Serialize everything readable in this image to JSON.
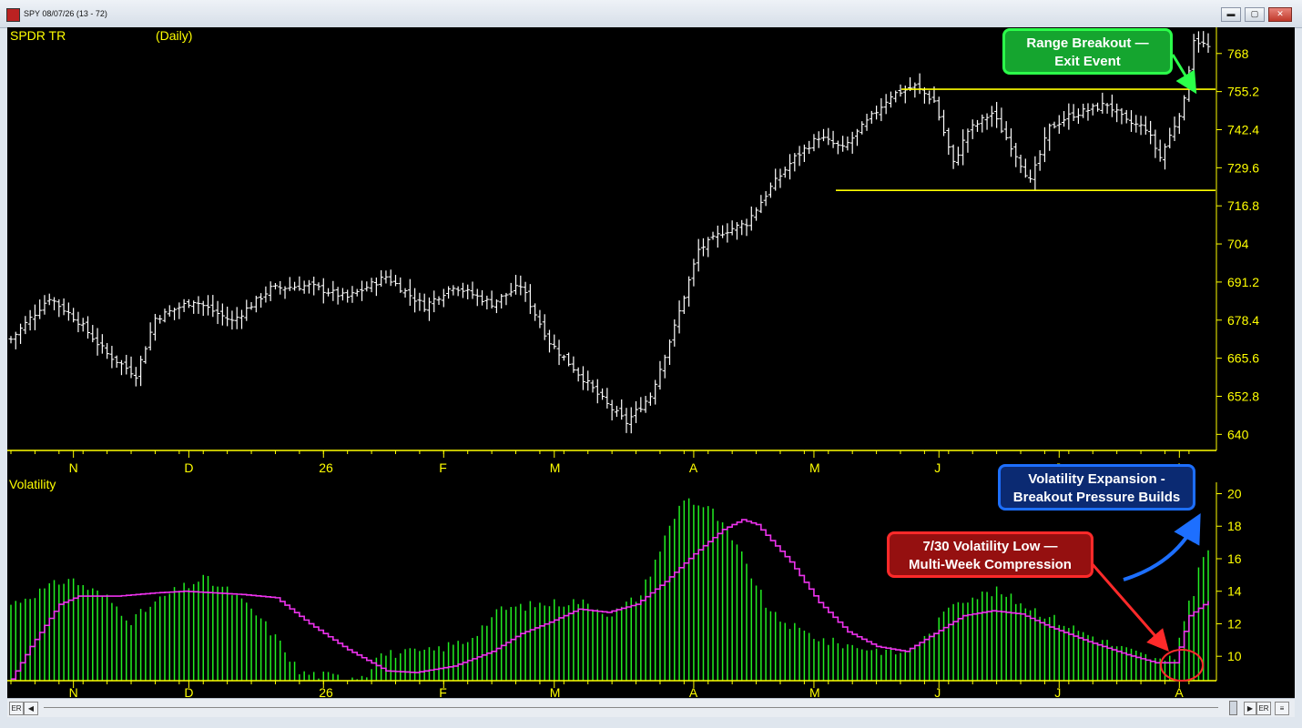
{
  "window": {
    "title": "SPY 08/07/26 (13 - 72)",
    "minimize_label": "▬",
    "maximize_label": "▢",
    "close_label": "✕"
  },
  "price_panel": {
    "symbol": "SPDR TR",
    "period": "(Daily)"
  },
  "volatility_panel": {
    "label": "Volatility"
  },
  "scrollbar": {
    "left_er": "ER",
    "left_arrow": "◀",
    "right_arrow": "▶",
    "right_er": "ER",
    "menu": "≡"
  },
  "annotations": {
    "green": {
      "line1": "Range Breakout —",
      "line2": "Exit Event"
    },
    "blue": {
      "line1": "Volatility Expansion -",
      "line2": "Breakout Pressure Builds"
    },
    "red": {
      "line1": "7/30 Volatility Low —",
      "line2": "Multi-Week Compression"
    }
  },
  "colors": {
    "background": "#000000",
    "axis": "#ffff00",
    "bars": "#ffffff",
    "volatility": "#22ee22",
    "volatility_ma": "#ee33ee",
    "range_lines": "#ffff00"
  },
  "chart_data": [
    {
      "type": "line",
      "subtype": "ohlc",
      "title": "SPDR TR",
      "period": "(Daily)",
      "x_ticks": [
        "N",
        "D",
        "26",
        "F",
        "M",
        "A",
        "M",
        "J",
        "J",
        "A"
      ],
      "y_ticks": [
        640,
        652.8,
        665.6,
        678.4,
        691.2,
        704,
        716.8,
        729.6,
        742.4,
        755.2,
        768
      ],
      "ylim": [
        634.6,
        776.8
      ],
      "horizontal_lines": [
        {
          "value": 756,
          "label": "range high"
        },
        {
          "value": 722,
          "label": "range low"
        }
      ],
      "close_anchors": [
        [
          0,
          672
        ],
        [
          8,
          686
        ],
        [
          14,
          678
        ],
        [
          20,
          667
        ],
        [
          26,
          660
        ],
        [
          30,
          679
        ],
        [
          38,
          685
        ],
        [
          46,
          678
        ],
        [
          54,
          689
        ],
        [
          62,
          690
        ],
        [
          70,
          686
        ],
        [
          78,
          693
        ],
        [
          86,
          683
        ],
        [
          92,
          690
        ],
        [
          100,
          684
        ],
        [
          106,
          690
        ],
        [
          112,
          671
        ],
        [
          120,
          657
        ],
        [
          124,
          650
        ],
        [
          128,
          644
        ],
        [
          133,
          653
        ],
        [
          138,
          676
        ],
        [
          143,
          702
        ],
        [
          148,
          708
        ],
        [
          153,
          711
        ],
        [
          158,
          723
        ],
        [
          163,
          733
        ],
        [
          168,
          740
        ],
        [
          173,
          736
        ],
        [
          178,
          745
        ],
        [
          183,
          754
        ],
        [
          188,
          757
        ],
        [
          192,
          752
        ],
        [
          196,
          731
        ],
        [
          199,
          742
        ],
        [
          204,
          748
        ],
        [
          208,
          737
        ],
        [
          212,
          725
        ],
        [
          216,
          743
        ],
        [
          220,
          747
        ],
        [
          224,
          749
        ],
        [
          228,
          751
        ],
        [
          232,
          745
        ],
        [
          236,
          743
        ],
        [
          239,
          733
        ],
        [
          242,
          744
        ],
        [
          244,
          752
        ],
        [
          245,
          763
        ],
        [
          246,
          773
        ],
        [
          249,
          770
        ]
      ],
      "n_bars": 250
    },
    {
      "type": "bar",
      "title": "Volatility",
      "y_ticks": [
        10,
        12,
        14,
        16,
        18,
        20
      ],
      "ylim": [
        8.5,
        20.7
      ],
      "volatility_anchors": [
        [
          0,
          13.2
        ],
        [
          12,
          14.8
        ],
        [
          20,
          13.6
        ],
        [
          25,
          12.2
        ],
        [
          32,
          13.7
        ],
        [
          40,
          14.8
        ],
        [
          46,
          13.9
        ],
        [
          52,
          12.3
        ],
        [
          57,
          10.4
        ],
        [
          60,
          9.0
        ],
        [
          69,
          8.7
        ],
        [
          74,
          8.9
        ],
        [
          76,
          10.1
        ],
        [
          87,
          10.3
        ],
        [
          95,
          11.0
        ],
        [
          102,
          12.9
        ],
        [
          110,
          13.2
        ],
        [
          118,
          13.4
        ],
        [
          125,
          12.6
        ],
        [
          131,
          13.8
        ],
        [
          136,
          17.3
        ],
        [
          140,
          19.8
        ],
        [
          146,
          18.9
        ],
        [
          152,
          16.2
        ],
        [
          158,
          12.6
        ],
        [
          164,
          11.6
        ],
        [
          170,
          10.9
        ],
        [
          180,
          10.4
        ],
        [
          186,
          10.2
        ],
        [
          191,
          11.3
        ],
        [
          196,
          13.4
        ],
        [
          205,
          14.0
        ],
        [
          212,
          13.0
        ],
        [
          222,
          11.6
        ],
        [
          230,
          10.6
        ],
        [
          240,
          9.6
        ],
        [
          242,
          9.9
        ],
        [
          244,
          12.4
        ],
        [
          246,
          14.0
        ],
        [
          247,
          15.5
        ],
        [
          249,
          16.4
        ]
      ],
      "ma_anchors": [
        [
          0,
          8.6
        ],
        [
          4,
          10.6
        ],
        [
          10,
          13.2
        ],
        [
          14,
          13.7
        ],
        [
          22,
          13.7
        ],
        [
          30,
          13.9
        ],
        [
          36,
          14.0
        ],
        [
          42,
          13.9
        ],
        [
          48,
          13.8
        ],
        [
          55,
          13.6
        ],
        [
          62,
          12.0
        ],
        [
          70,
          10.4
        ],
        [
          78,
          9.1
        ],
        [
          84,
          9.0
        ],
        [
          92,
          9.4
        ],
        [
          100,
          10.3
        ],
        [
          106,
          11.4
        ],
        [
          112,
          12.1
        ],
        [
          118,
          12.9
        ],
        [
          124,
          12.7
        ],
        [
          130,
          13.2
        ],
        [
          136,
          14.6
        ],
        [
          142,
          16.3
        ],
        [
          148,
          17.8
        ],
        [
          152,
          18.4
        ],
        [
          155,
          18.1
        ],
        [
          162,
          15.8
        ],
        [
          168,
          13.3
        ],
        [
          174,
          11.5
        ],
        [
          180,
          10.6
        ],
        [
          186,
          10.3
        ],
        [
          192,
          11.4
        ],
        [
          198,
          12.5
        ],
        [
          204,
          12.8
        ],
        [
          210,
          12.6
        ],
        [
          216,
          11.8
        ],
        [
          224,
          10.9
        ],
        [
          232,
          10.1
        ],
        [
          238,
          9.6
        ],
        [
          242,
          9.6
        ],
        [
          245,
          12.5
        ],
        [
          249,
          13.4
        ]
      ]
    }
  ]
}
